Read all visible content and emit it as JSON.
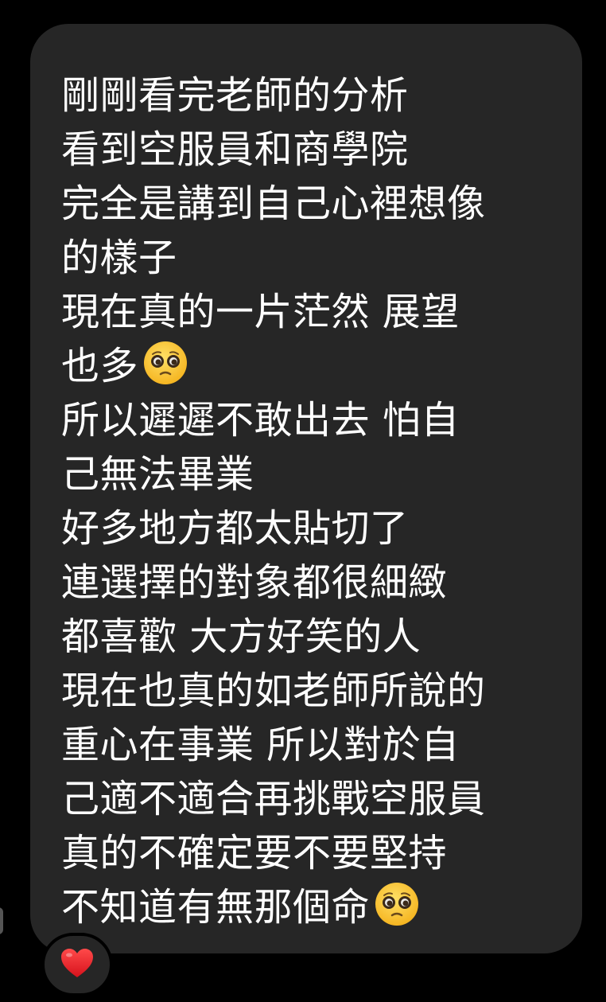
{
  "message": {
    "lines": [
      {
        "text": "剛剛看完老師的分析"
      },
      {
        "text": "看到空服員和商學院"
      },
      {
        "text": "完全是講到自己心裡想像"
      },
      {
        "text": "的樣子"
      },
      {
        "text": "現在真的一片茫然 展望"
      },
      {
        "text": "也多",
        "emoji": "pleading-face-emoji"
      },
      {
        "text": "所以遲遲不敢出去 怕自"
      },
      {
        "text": "己無法畢業"
      },
      {
        "text": "好多地方都太貼切了"
      },
      {
        "text": "連選擇的對象都很細緻"
      },
      {
        "text": "都喜歡 大方好笑的人"
      },
      {
        "text": "現在也真的如老師所說的"
      },
      {
        "text": "重心在事業 所以對於自"
      },
      {
        "text": "己適不適合再挑戰空服員"
      },
      {
        "text": "真的不確定要不要堅持"
      },
      {
        "text": "不知道有無那個命",
        "emoji": "pleading-face-emoji"
      }
    ]
  },
  "reaction": {
    "icon": "red-heart-icon",
    "color": "#e8202a"
  },
  "theme": {
    "background": "#000000",
    "bubble": "#262626",
    "text": "#ffffff"
  }
}
